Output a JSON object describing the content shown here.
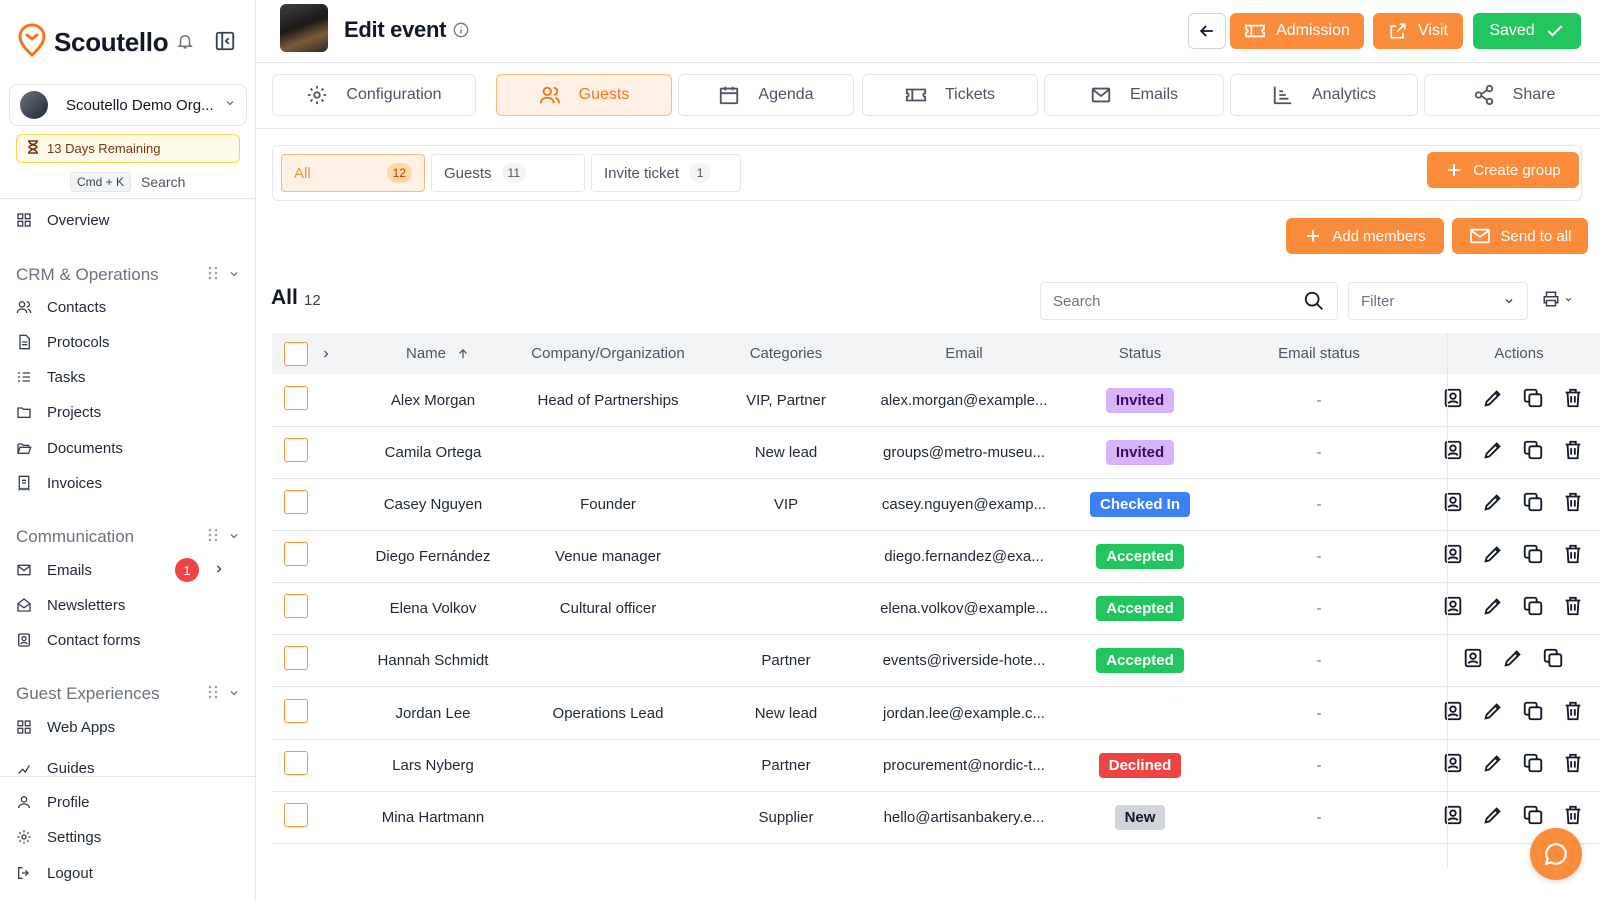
{
  "app": {
    "brand": "Scoutello"
  },
  "sidebar": {
    "org_name": "Scoutello Demo Org...",
    "trial": "13 Days Remaining",
    "search_kbd": "Cmd + K",
    "search_label": "Search",
    "overview": "Overview",
    "sections": [
      {
        "title": "CRM & Operations",
        "items": [
          "Contacts",
          "Protocols",
          "Tasks",
          "Projects",
          "Documents",
          "Invoices"
        ]
      },
      {
        "title": "Communication",
        "items": [
          "Emails",
          "Newsletters",
          "Contact forms"
        ],
        "emails_badge": "1"
      },
      {
        "title": "Guest Experiences",
        "items": [
          "Web Apps",
          "Guides"
        ]
      }
    ],
    "footer": [
      "Profile",
      "Settings",
      "Logout"
    ]
  },
  "header": {
    "title": "Edit event",
    "admission": "Admission",
    "visit": "Visit",
    "saved": "Saved"
  },
  "tabs": [
    "Configuration",
    "Guests",
    "Agenda",
    "Tickets",
    "Emails",
    "Analytics",
    "Share"
  ],
  "filters": [
    {
      "label": "All",
      "count": "12"
    },
    {
      "label": "Guests",
      "count": "11"
    },
    {
      "label": "Invite ticket",
      "count": "1"
    }
  ],
  "buttons": {
    "create_group": "Create group",
    "add_members": "Add members",
    "send_to_all": "Send to all"
  },
  "list": {
    "title": "All",
    "count": "12",
    "search_placeholder": "Search",
    "filter_placeholder": "Filter"
  },
  "table": {
    "columns": [
      "Name",
      "Company/Organization",
      "Categories",
      "Email",
      "Status",
      "Email status",
      "Actions"
    ],
    "rows": [
      {
        "name": "Alex Morgan",
        "company": "Head of Partnerships",
        "categories": "VIP, Partner",
        "email": "alex.morgan@example...",
        "status": "Invited",
        "status_kind": "invited",
        "email_status": "-"
      },
      {
        "name": "Camila Ortega",
        "company": "",
        "categories": "New lead",
        "email": "groups@metro-museu...",
        "status": "Invited",
        "status_kind": "invited",
        "email_status": "-"
      },
      {
        "name": "Casey Nguyen",
        "company": "Founder",
        "categories": "VIP",
        "email": "casey.nguyen@examp...",
        "status": "Checked In",
        "status_kind": "checked",
        "email_status": "-"
      },
      {
        "name": "Diego Fernández",
        "company": "Venue manager",
        "categories": "",
        "email": "diego.fernandez@exa...",
        "status": "Accepted",
        "status_kind": "accepted",
        "email_status": "-"
      },
      {
        "name": "Elena Volkov",
        "company": "Cultural officer",
        "categories": "",
        "email": "elena.volkov@example...",
        "status": "Accepted",
        "status_kind": "accepted",
        "email_status": "-"
      },
      {
        "name": "Hannah Schmidt",
        "company": "",
        "categories": "Partner",
        "email": "events@riverside-hote...",
        "status": "Accepted",
        "status_kind": "accepted",
        "email_status": "-"
      },
      {
        "name": "Jordan Lee",
        "company": "Operations Lead",
        "categories": "New lead",
        "email": "jordan.lee@example.c...",
        "status": "",
        "status_kind": "",
        "email_status": "-"
      },
      {
        "name": "Lars Nyberg",
        "company": "",
        "categories": "Partner",
        "email": "procurement@nordic-t...",
        "status": "Declined",
        "status_kind": "declined",
        "email_status": "-"
      },
      {
        "name": "Mina Hartmann",
        "company": "",
        "categories": "Supplier",
        "email": "hello@artisanbakery.e...",
        "status": "New",
        "status_kind": "new",
        "email_status": "-"
      }
    ]
  },
  "colors": {
    "accent": "#fb8c3c",
    "success": "#22c55e",
    "danger": "#ef4444",
    "info": "#3b82f6"
  }
}
